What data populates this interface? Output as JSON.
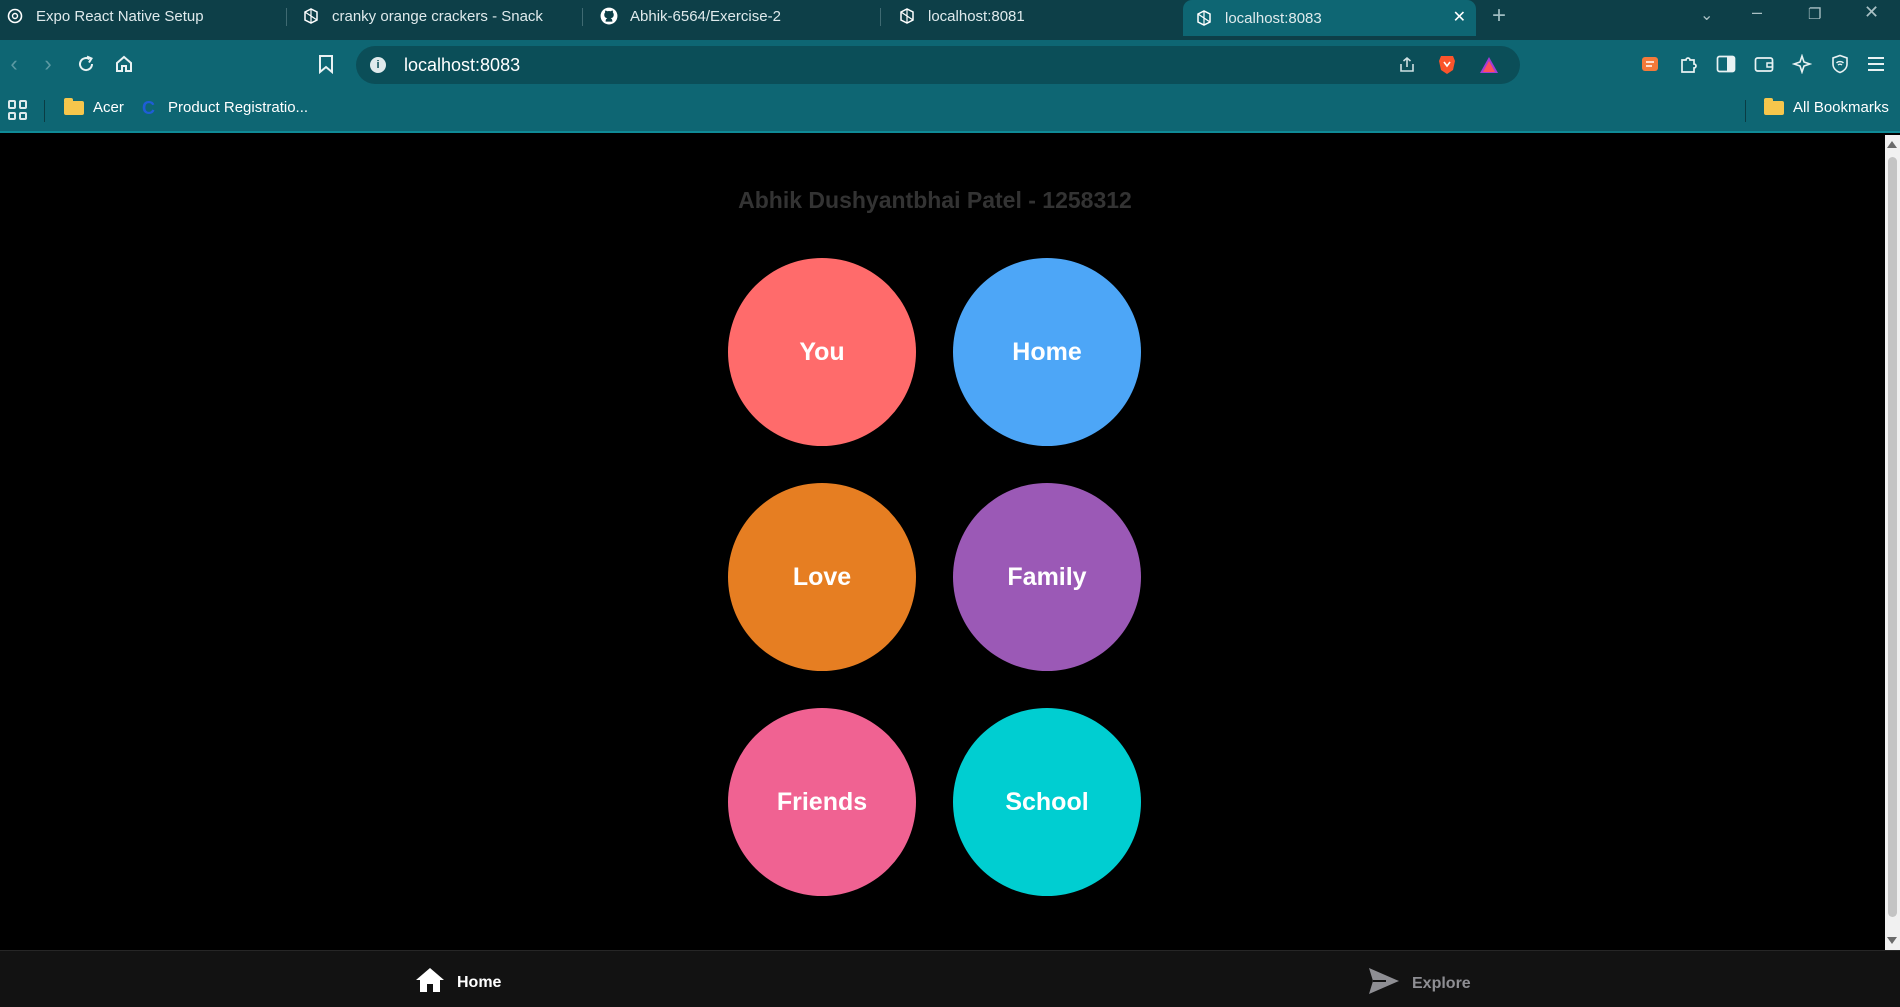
{
  "tabs": [
    {
      "label": "Expo React Native Setup",
      "icon": "openai-icon",
      "active": false
    },
    {
      "label": "cranky orange crackers - Snack",
      "icon": "snack-icon",
      "active": false
    },
    {
      "label": "Abhik-6564/Exercise-2",
      "icon": "github-icon",
      "active": false
    },
    {
      "label": "localhost:8081",
      "icon": "snack-icon",
      "active": false
    },
    {
      "label": "localhost:8083",
      "icon": "snack-icon",
      "active": true
    }
  ],
  "address_bar": {
    "url": "localhost:8083"
  },
  "bookmarks": {
    "items": [
      {
        "label": "Acer",
        "icon": "folder-icon"
      },
      {
        "label": "Product Registratio...",
        "icon": "c-logo-icon"
      }
    ],
    "all_label": "All Bookmarks"
  },
  "page": {
    "title": "Abhik Dushyantbhai Patel - 1258312",
    "circles": [
      {
        "label": "You",
        "color": "#FF6B6B"
      },
      {
        "label": "Home",
        "color": "#4DA6F7"
      },
      {
        "label": "Love",
        "color": "#E67E22"
      },
      {
        "label": "Family",
        "color": "#9B59B6"
      },
      {
        "label": "Friends",
        "color": "#F06292"
      },
      {
        "label": "School",
        "color": "#00CED1"
      }
    ]
  },
  "bottom_tabs": [
    {
      "label": "Home",
      "icon": "home-icon",
      "active": true,
      "color": "#FFFFFF"
    },
    {
      "label": "Explore",
      "icon": "send-icon",
      "active": false,
      "color": "#8E8E93"
    }
  ]
}
